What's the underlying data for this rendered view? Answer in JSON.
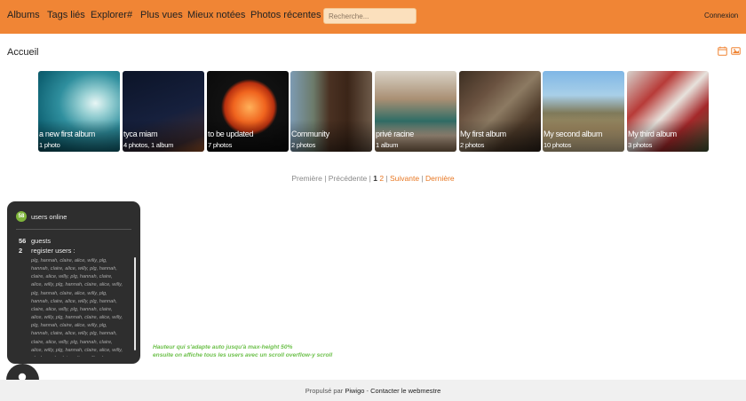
{
  "nav": {
    "items": [
      "Albums",
      "Tags liés",
      "Explorer#",
      "Plus vues",
      "Mieux notées",
      "Photos récentes"
    ],
    "search_placeholder": "Recherche...",
    "login_label": "Connexion"
  },
  "header": {
    "title": "Accueil",
    "icons": [
      "calendar-icon",
      "slideshow-icon"
    ],
    "accent_color": "#f08535"
  },
  "albums": [
    {
      "name": "a new first album",
      "count": "1 photo"
    },
    {
      "name": "tyca miam",
      "count": "4 photos, 1 album"
    },
    {
      "name": "to be updated",
      "count": "7 photos"
    },
    {
      "name": "Community",
      "count": "2 photos"
    },
    {
      "name": "privé racine",
      "count": "1 album"
    },
    {
      "name": "My first album",
      "count": "2 photos"
    },
    {
      "name": "My second album",
      "count": "10 photos"
    },
    {
      "name": "My third album",
      "count": "3 photos"
    }
  ],
  "pagination": {
    "first": "Première",
    "prev": "Précédente",
    "current": "1",
    "page2": "2",
    "next": "Suivante",
    "last": "Dernière"
  },
  "online": {
    "badge": "58",
    "title": "users online",
    "guests_count": "56",
    "guests_label": "guests",
    "registered_count": "2",
    "registered_label": "register users :",
    "users_text": "plg, hannah, claire, alice, willy, plg, hannah, claire, alice, willy, plg, hannah, claire, alice, willy, plg, hannah, claire, alice, willy, plg, hannah, claire, alice, willy, plg, hannah, claire, alice, willy, plg, hannah, claire, alice, willy, plg, hannah, claire, alice, willy, plg, hannah, claire, alice, willy, plg, hannah, claire, alice, willy, plg, hannah, claire, alice, willy, plg, hannah, claire, alice, willy, plg, hannah, claire, alice, willy, plg, hannah, claire, alice, willy, plg, hannah, claire, alice, willy, plg, hannah, claire, alice, willy, plg, hannah, claire, alice, willy, plg, hannah, claire, alice, willy, plg, hannah, claire, alice, willy"
  },
  "note": {
    "line1": "Hauteur qui s'adapte auto jusqu'à max-height 50%",
    "line2": "ensuite on affiche tous les users avec un scroll overflow-y scroll"
  },
  "footer": {
    "prefix": "Propulsé par",
    "piwigo": "Piwigo",
    "separator": " - ",
    "contact": "Contacter le webmestre"
  }
}
